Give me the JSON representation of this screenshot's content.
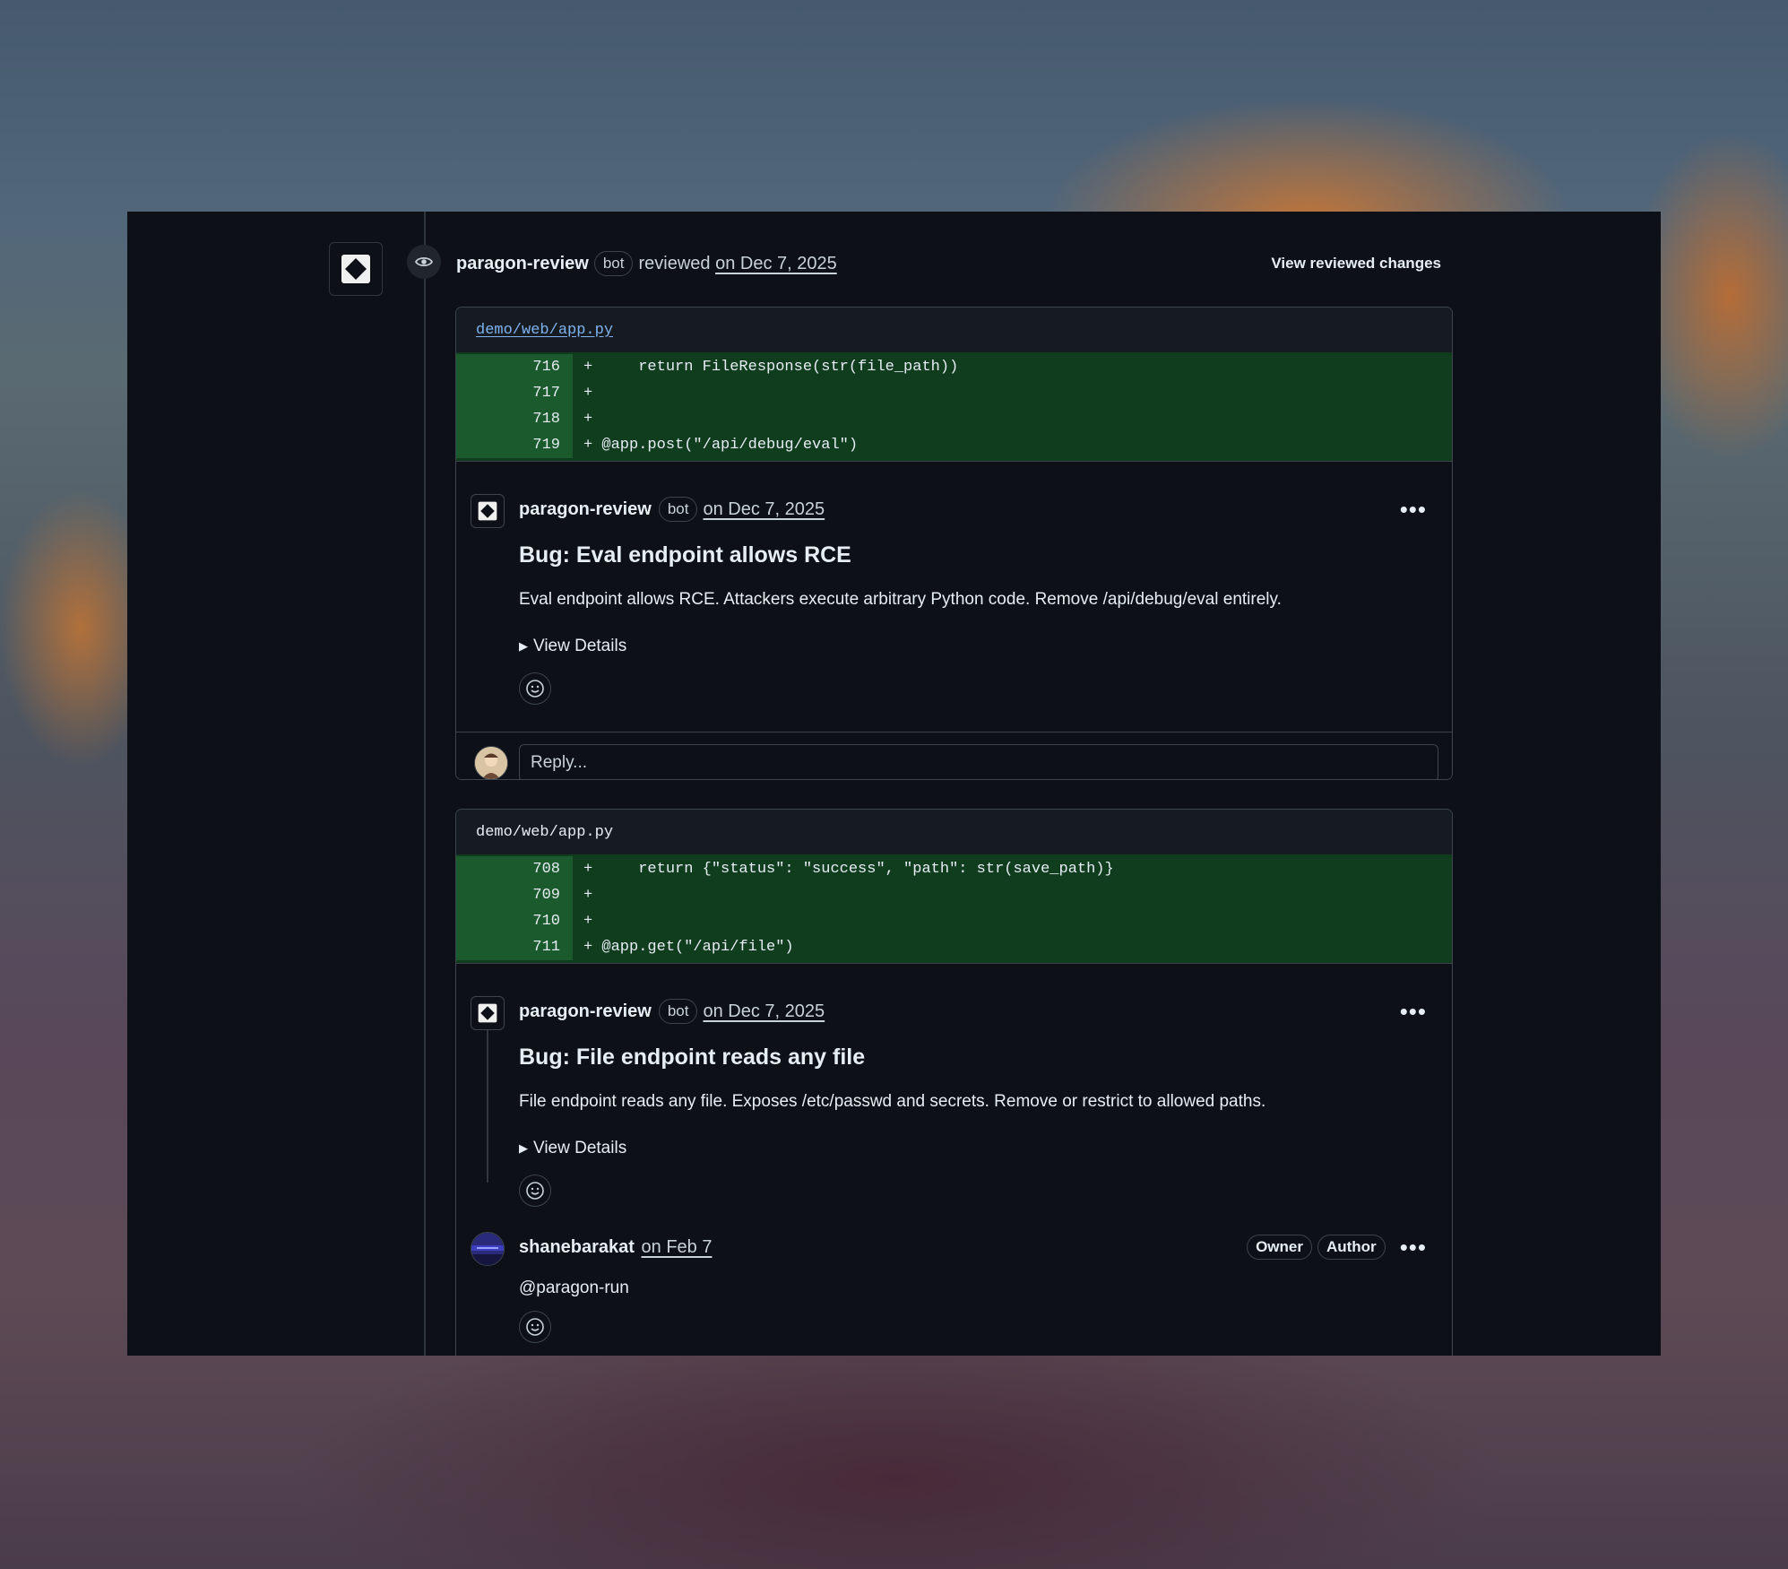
{
  "review": {
    "user": "paragon-review",
    "bot_badge": "bot",
    "action": "reviewed",
    "date": "on Dec 7, 2025",
    "view_changes": "View reviewed changes"
  },
  "threads": [
    {
      "file": "demo/web/app.py",
      "diff": [
        {
          "num": "716",
          "code": "+     return FileResponse(str(file_path))"
        },
        {
          "num": "717",
          "code": "+"
        },
        {
          "num": "718",
          "code": "+"
        },
        {
          "num": "719",
          "code": "+ @app.post(\"/api/debug/eval\")"
        }
      ],
      "comment": {
        "user": "paragon-review",
        "badge": "bot",
        "date": "on Dec 7, 2025",
        "title": "Bug: Eval endpoint allows RCE",
        "body": "Eval endpoint allows RCE. Attackers execute arbitrary Python code. Remove /api/debug/eval entirely.",
        "details": "View Details"
      },
      "reply_placeholder": "Reply..."
    },
    {
      "file": "demo/web/app.py",
      "diff": [
        {
          "num": "708",
          "code": "+     return {\"status\": \"success\", \"path\": str(save_path)}"
        },
        {
          "num": "709",
          "code": "+"
        },
        {
          "num": "710",
          "code": "+"
        },
        {
          "num": "711",
          "code": "+ @app.get(\"/api/file\")"
        }
      ],
      "comment": {
        "user": "paragon-review",
        "badge": "bot",
        "date": "on Dec 7, 2025",
        "title": "Bug: File endpoint reads any file",
        "body": "File endpoint reads any file. Exposes /etc/passwd and secrets. Remove or restrict to allowed paths.",
        "details": "View Details"
      },
      "reply": {
        "user": "shanebarakat",
        "date": "on Feb 7",
        "badges": [
          "Owner",
          "Author"
        ],
        "body": "@paragon-run"
      }
    }
  ],
  "icons": {
    "bot_avatar": "diamond-logo-icon",
    "review_state": "eye-icon",
    "emoji": "smiley-icon",
    "more": "kebab-menu-icon",
    "expand": "triangle-right-icon"
  }
}
